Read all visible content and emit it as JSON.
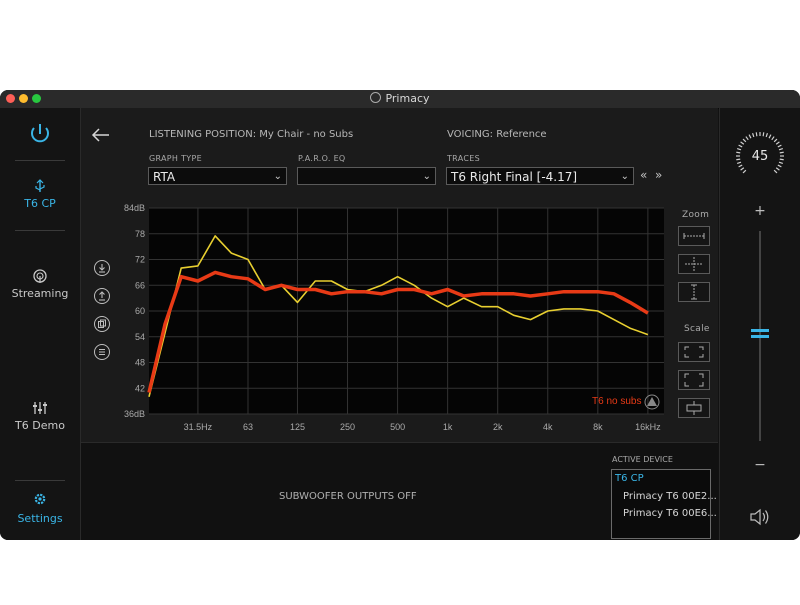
{
  "window": {
    "title": "Primacy"
  },
  "sidebar": {
    "items": [
      {
        "name": "power",
        "label": ""
      },
      {
        "name": "t6cp",
        "label": "T6 CP"
      },
      {
        "name": "streaming",
        "label": "Streaming"
      },
      {
        "name": "t6demo",
        "label": "T6 Demo"
      },
      {
        "name": "settings",
        "label": "Settings"
      }
    ]
  },
  "header": {
    "listening_position": "LISTENING POSITION: My Chair - no Subs",
    "voicing": "VOICING: Reference"
  },
  "controls": {
    "graph_type_label": "GRAPH TYPE",
    "graph_type_value": "RTA",
    "paro_label": "P.A.R.O. EQ",
    "paro_value": "",
    "traces_label": "TRACES",
    "traces_value": "T6 Right Final [-4.17]",
    "nav_prev": "«",
    "nav_next": "»"
  },
  "right_tools": {
    "zoom_label": "Zoom",
    "scale_label": "Scale"
  },
  "chart_data": {
    "type": "line",
    "x_scale": "log",
    "x_ticks": [
      {
        "value": 31.5,
        "label": "31.5Hz"
      },
      {
        "value": 63,
        "label": "63"
      },
      {
        "value": 125,
        "label": "125"
      },
      {
        "value": 250,
        "label": "250"
      },
      {
        "value": 500,
        "label": "500"
      },
      {
        "value": 1000,
        "label": "1k"
      },
      {
        "value": 2000,
        "label": "2k"
      },
      {
        "value": 4000,
        "label": "4k"
      },
      {
        "value": 8000,
        "label": "8k"
      },
      {
        "value": 16000,
        "label": "16kHz"
      }
    ],
    "y_ticks": [
      {
        "value": 84,
        "label": "84dB"
      },
      {
        "value": 78,
        "label": "78"
      },
      {
        "value": 72,
        "label": "72"
      },
      {
        "value": 66,
        "label": "66"
      },
      {
        "value": 60,
        "label": "60"
      },
      {
        "value": 54,
        "label": "54"
      },
      {
        "value": 48,
        "label": "48"
      },
      {
        "value": 42,
        "label": "42"
      },
      {
        "value": 36,
        "label": "36dB"
      }
    ],
    "xlim": [
      16,
      20000
    ],
    "ylim": [
      36,
      84
    ],
    "grid": true,
    "series": [
      {
        "name": "T6 no subs",
        "color": "#e83a16",
        "x": [
          16,
          20,
          25,
          31.5,
          40,
          50,
          63,
          80,
          100,
          125,
          160,
          200,
          250,
          315,
          400,
          500,
          630,
          800,
          1000,
          1250,
          1600,
          2000,
          2500,
          3150,
          4000,
          5000,
          6300,
          8000,
          10000,
          12500,
          16000
        ],
        "y": [
          41,
          57,
          68,
          67,
          69,
          68,
          67.5,
          65,
          66,
          65,
          65,
          64,
          64.5,
          64.5,
          64,
          65,
          65,
          64,
          65,
          63.5,
          64,
          64,
          64,
          63.5,
          64,
          64.5,
          64.5,
          64.5,
          64,
          62,
          59.5
        ]
      },
      {
        "name": "",
        "color": "#e8cf30",
        "x": [
          16,
          20,
          25,
          31.5,
          40,
          50,
          63,
          80,
          100,
          125,
          160,
          200,
          250,
          315,
          400,
          500,
          630,
          800,
          1000,
          1250,
          1600,
          2000,
          2500,
          3150,
          4000,
          5000,
          6300,
          8000,
          10000,
          12500,
          16000
        ],
        "y": [
          40,
          55,
          70,
          70.5,
          77.5,
          73.5,
          72,
          65,
          66,
          62,
          67,
          67,
          65,
          64.5,
          66,
          68,
          66,
          63,
          61,
          63,
          61,
          61,
          59,
          58,
          60,
          60.5,
          60.5,
          60,
          58,
          56,
          54.5
        ]
      }
    ]
  },
  "bottom": {
    "subwoofer_status": "SUBWOOFER OUTPUTS OFF",
    "active_device_label": "ACTIVE DEVICE",
    "devices": [
      "T6 CP",
      "Primacy T6 00E2...",
      "Primacy T6 00E6..."
    ]
  },
  "volume": {
    "value": "45",
    "plus": "+",
    "minus": "−",
    "level": 0.51
  },
  "colors": {
    "accent": "#3ab5e6",
    "red_trace": "#e83a16",
    "yellow_trace": "#e8cf30"
  }
}
